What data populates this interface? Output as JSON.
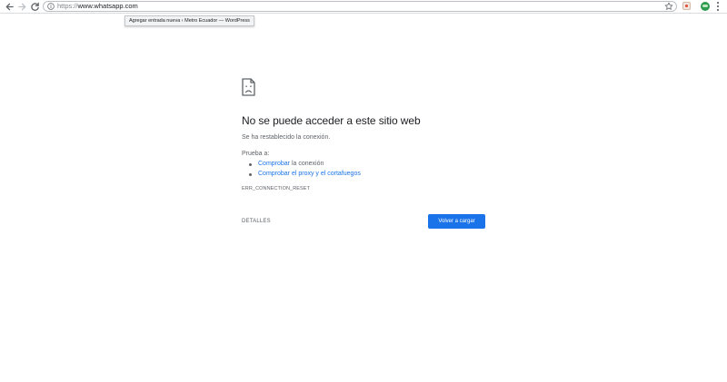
{
  "browser": {
    "url_scheme": "https://",
    "url_host": "www.whatsapp.com",
    "tooltip": "Agregar entrada nueva ‹ Metro Ecuador — WordPress",
    "icons": {
      "back": "back-arrow-icon",
      "forward": "forward-arrow-icon",
      "reload": "reload-icon",
      "site_info": "info-icon",
      "bookmark": "star-icon",
      "extension": "extension-icon",
      "profile": "avatar",
      "menu": "kebab-menu-icon"
    }
  },
  "error": {
    "icon": "sad-page-icon",
    "title": "No se puede acceder a este sitio web",
    "description": "Se ha restablecido la conexión.",
    "suggestions_heading": "Prueba a:",
    "suggestions": [
      {
        "label": "Comprobar la conexión",
        "link_part": "Comprobar",
        "rest": " la conexión"
      },
      {
        "label": "Comprobar el proxy y el cortafuegos"
      }
    ],
    "code": "ERR_CONNECTION_RESET",
    "details_label": "DETALLES",
    "reload_label": "Volver a cargar"
  },
  "colors": {
    "accent": "#1a73e8",
    "text_primary": "#202124",
    "text_secondary": "#5f6368"
  }
}
